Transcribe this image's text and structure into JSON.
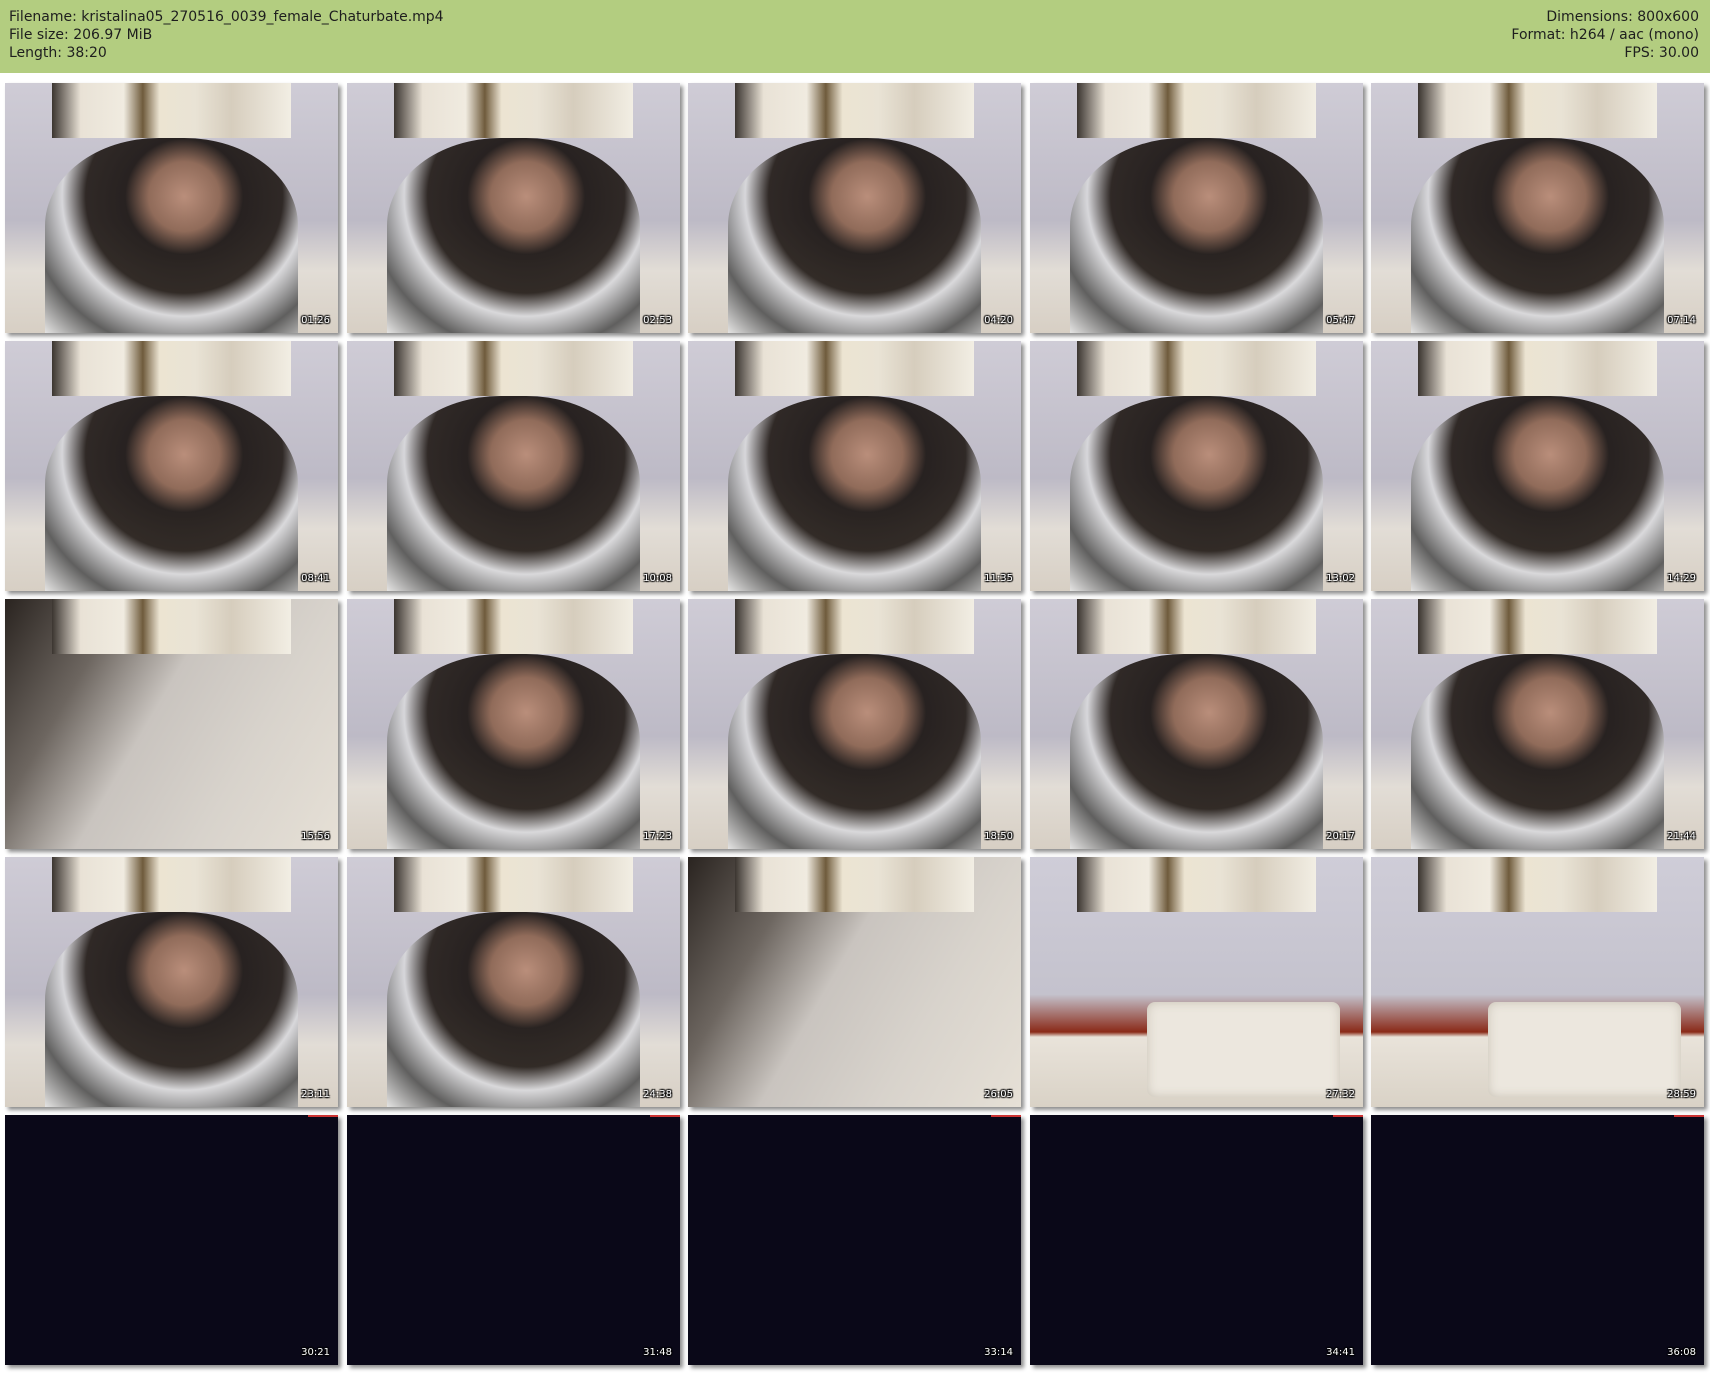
{
  "header": {
    "filename": "Filename: kristalina05_270516_0039_female_Chaturbate.mp4",
    "filesize": "File size: 206.97 MiB",
    "length": "Length: 38:20",
    "dimensions": "Dimensions: 800x600",
    "format": "Format: h264 / aac (mono)",
    "fps": "FPS: 30.00",
    "background_color": "#b3cd80"
  },
  "thumbnails": [
    {
      "timestamp": "01:26",
      "scene": "bedroom"
    },
    {
      "timestamp": "02:53",
      "scene": "bedroom"
    },
    {
      "timestamp": "04:20",
      "scene": "bedroom"
    },
    {
      "timestamp": "05:47",
      "scene": "bedroom"
    },
    {
      "timestamp": "07:14",
      "scene": "bedroom"
    },
    {
      "timestamp": "08:41",
      "scene": "bedroom"
    },
    {
      "timestamp": "10:08",
      "scene": "bedroom"
    },
    {
      "timestamp": "11:35",
      "scene": "bedroom"
    },
    {
      "timestamp": "13:02",
      "scene": "bedroom"
    },
    {
      "timestamp": "14:29",
      "scene": "bedroom"
    },
    {
      "timestamp": "15:56",
      "scene": "blur"
    },
    {
      "timestamp": "17:23",
      "scene": "bedroom"
    },
    {
      "timestamp": "18:50",
      "scene": "bedroom"
    },
    {
      "timestamp": "20:17",
      "scene": "bedroom"
    },
    {
      "timestamp": "21:44",
      "scene": "bedroom"
    },
    {
      "timestamp": "23:11",
      "scene": "bedroom"
    },
    {
      "timestamp": "24:38",
      "scene": "bedroom"
    },
    {
      "timestamp": "26:05",
      "scene": "blur"
    },
    {
      "timestamp": "27:32",
      "scene": "empty"
    },
    {
      "timestamp": "28:59",
      "scene": "empty"
    },
    {
      "timestamp": "30:21",
      "scene": "dark"
    },
    {
      "timestamp": "31:48",
      "scene": "dark"
    },
    {
      "timestamp": "33:14",
      "scene": "dark"
    },
    {
      "timestamp": "34:41",
      "scene": "dark"
    },
    {
      "timestamp": "36:08",
      "scene": "dark"
    }
  ]
}
